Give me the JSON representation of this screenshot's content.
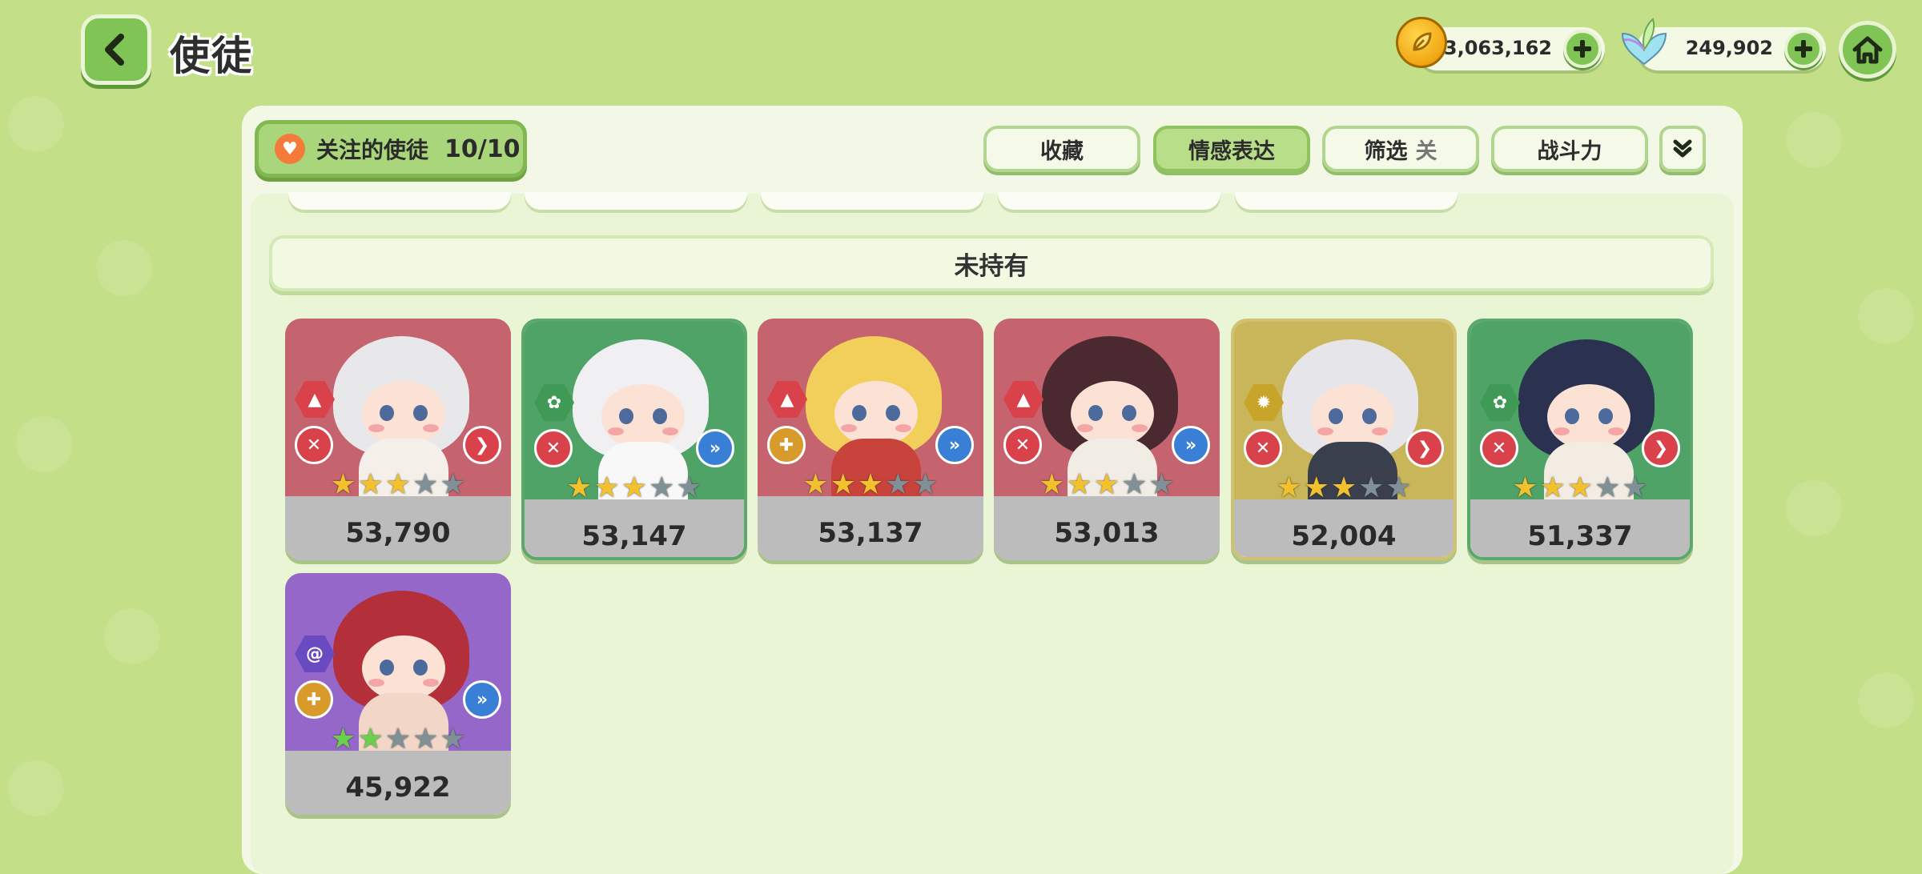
{
  "header": {
    "title": "使徒"
  },
  "resources": {
    "coins": "13,063,162",
    "gems": "249,902"
  },
  "toolbar": {
    "favorites_label": "关注的使徒",
    "favorites_count": "10/10",
    "tabs": [
      {
        "label": "收藏",
        "active": false
      },
      {
        "label": "情感表达",
        "active": true
      },
      {
        "label": "筛选",
        "suffix": "关",
        "active": false
      },
      {
        "label": "战斗力",
        "active": false
      }
    ]
  },
  "section": {
    "title": "未持有"
  },
  "cards": [
    {
      "power": "53,790",
      "color": "red",
      "element_icon": "fire-icon",
      "role_icon": "attack-icon",
      "class_icon": "forward-icon",
      "stars_filled": 3,
      "star_color": "gold"
    },
    {
      "power": "53,147",
      "color": "green",
      "element_icon": "clover-icon",
      "role_icon": "attack-icon",
      "class_icon": "speed-icon",
      "stars_filled": 3,
      "star_color": "gold"
    },
    {
      "power": "53,137",
      "color": "red",
      "element_icon": "fire-icon",
      "role_icon": "healer-icon",
      "class_icon": "speed-icon",
      "stars_filled": 3,
      "star_color": "gold"
    },
    {
      "power": "53,013",
      "color": "red",
      "element_icon": "fire-icon",
      "role_icon": "attack-icon",
      "class_icon": "speed-icon",
      "stars_filled": 3,
      "star_color": "gold"
    },
    {
      "power": "52,004",
      "color": "yellow",
      "element_icon": "sun-icon",
      "role_icon": "attack-icon",
      "class_icon": "forward-icon",
      "stars_filled": 3,
      "star_color": "gold"
    },
    {
      "power": "51,337",
      "color": "green",
      "element_icon": "clover-icon",
      "role_icon": "attack-icon",
      "class_icon": "forward-icon",
      "stars_filled": 3,
      "star_color": "gold"
    },
    {
      "power": "45,922",
      "color": "purple",
      "element_icon": "swirl-icon",
      "role_icon": "healer-icon",
      "class_icon": "speed-icon",
      "stars_filled": 2,
      "star_color": "green"
    }
  ],
  "colors": {
    "background": "#c3df88",
    "accent_green": "#7fc454",
    "card_red": "#c5636e",
    "card_green": "#4fa367",
    "card_yellow": "#c9b65a",
    "card_purple": "#9567c8"
  }
}
